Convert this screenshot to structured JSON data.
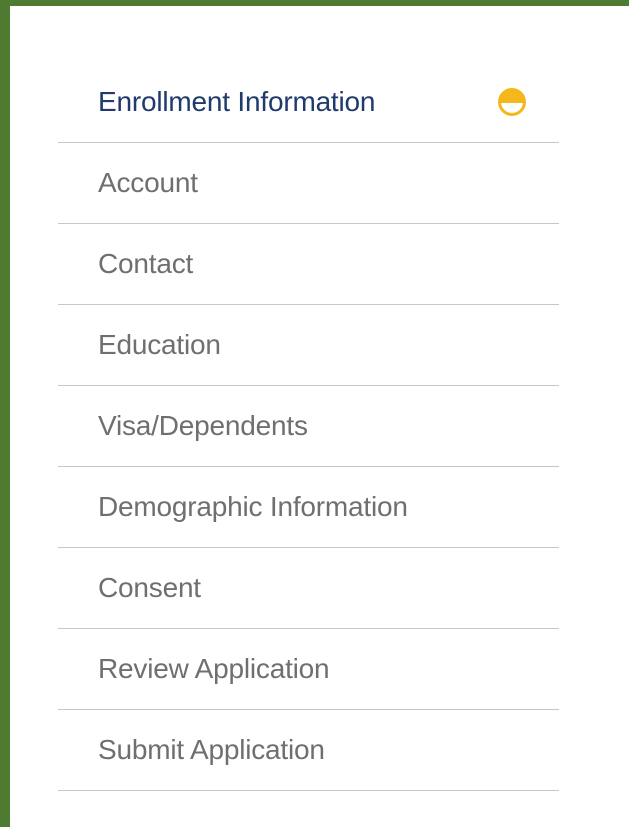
{
  "nav": {
    "items": [
      {
        "label": "Enrollment Information",
        "active": true,
        "status_icon": "half-complete-icon"
      },
      {
        "label": "Account"
      },
      {
        "label": "Contact"
      },
      {
        "label": "Education"
      },
      {
        "label": "Visa/Dependents"
      },
      {
        "label": "Demographic Information"
      },
      {
        "label": "Consent"
      },
      {
        "label": "Review Application"
      },
      {
        "label": "Submit Application"
      }
    ]
  },
  "colors": {
    "frame": "#4f7a32",
    "active_text": "#1f3a6b",
    "inactive_text": "#6f6f6f",
    "divider": "#c7c7c7",
    "status_icon": "#f5b81c"
  }
}
